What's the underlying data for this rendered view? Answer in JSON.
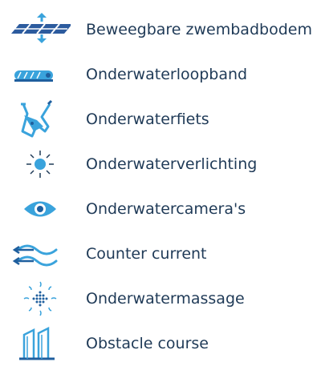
{
  "accent_color": "#3aa3dc",
  "text_color": "#1f3a57",
  "features": [
    {
      "icon": "movable-pool-floor-icon",
      "label": "Beweegbare zwembadbodem"
    },
    {
      "icon": "treadmill-icon",
      "label": "Onderwaterloopband"
    },
    {
      "icon": "underwater-bike-icon",
      "label": "Onderwaterfiets"
    },
    {
      "icon": "light-icon",
      "label": "Onderwaterverlichting"
    },
    {
      "icon": "eye-icon",
      "label": "Onderwatercamera's"
    },
    {
      "icon": "waves-icon",
      "label": "Counter current"
    },
    {
      "icon": "massage-icon",
      "label": "Onderwatermassage"
    },
    {
      "icon": "obstacle-course-icon",
      "label": "Obstacle course"
    }
  ]
}
